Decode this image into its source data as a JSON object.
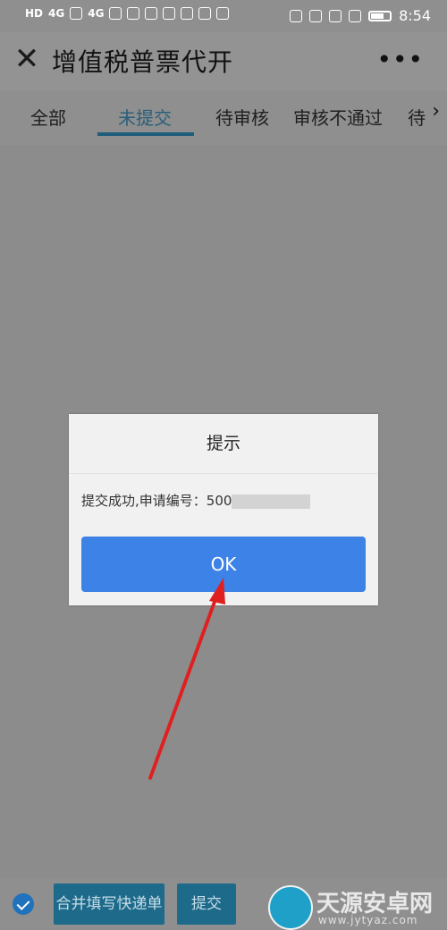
{
  "status_bar": {
    "left_texts": [
      "HD",
      "4G",
      "4G"
    ],
    "time": "8:54"
  },
  "header": {
    "title": "增值税普票代开",
    "more": "•••",
    "close": "✕"
  },
  "tabs": [
    {
      "label": "全部",
      "active": false
    },
    {
      "label": "未提交",
      "active": true
    },
    {
      "label": "待审核",
      "active": false
    },
    {
      "label": "审核不通过",
      "active": false
    },
    {
      "label": "待",
      "active": false
    }
  ],
  "dialog": {
    "title": "提示",
    "message_prefix": "提交成功,申请编号：",
    "application_number_visible": "500",
    "ok_label": "OK"
  },
  "bottom_bar": {
    "merge_button": "合并填写快递单",
    "submit_button": "提交"
  },
  "watermark": {
    "name": "天源安卓网",
    "url": "www.jytyaz.com"
  },
  "colors": {
    "ok_button": "#3d82e6",
    "arrow": "#e02020"
  }
}
